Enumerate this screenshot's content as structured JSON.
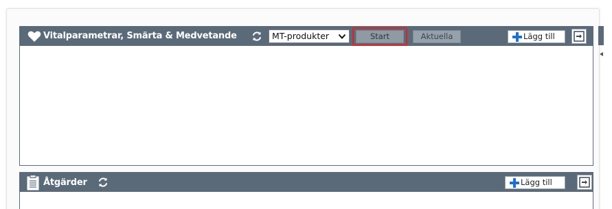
{
  "vitals_panel": {
    "title": "Vitalparametrar, Smärta & Medvetande",
    "selected_product": "MT-produkter",
    "start_label": "Start",
    "aktuella_label": "Aktuella",
    "add_label": "Lägg till",
    "icons": [
      "heart-icon",
      "refresh-icon",
      "chevron-down-icon",
      "plus-icon",
      "expand-icon"
    ]
  },
  "actions_panel": {
    "title": "Åtgärder",
    "add_label": "Lägg till",
    "icons": [
      "clipboard-icon",
      "refresh-icon",
      "plus-icon",
      "expand-icon"
    ]
  },
  "colors": {
    "header_bg": "#5b6a79",
    "highlight": "#e02222",
    "plus_blue": "#1f6fd1"
  }
}
